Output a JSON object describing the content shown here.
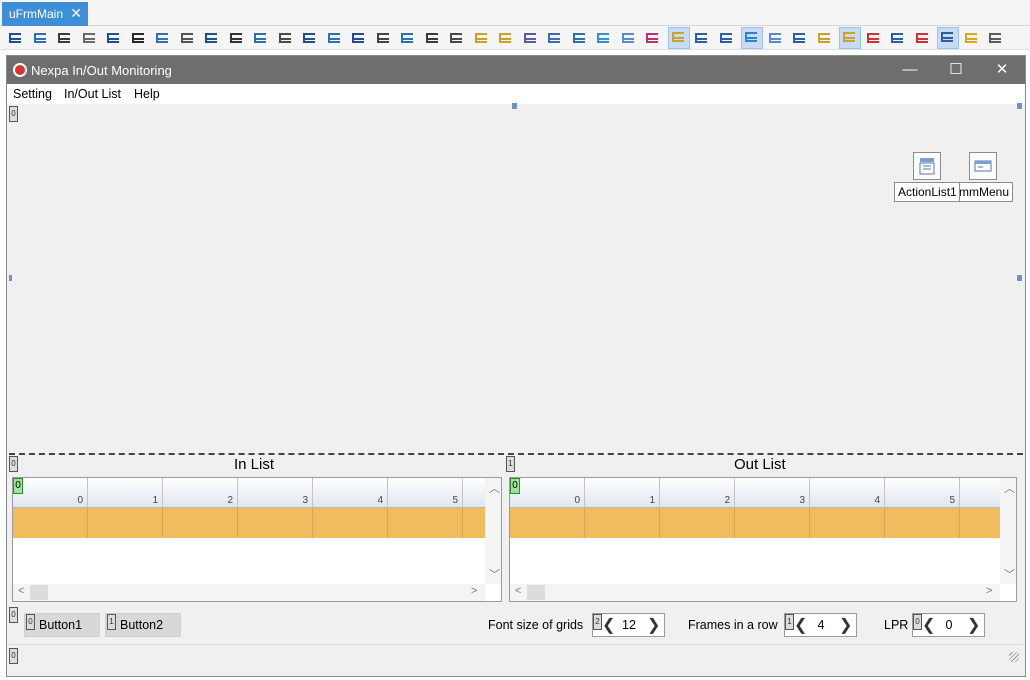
{
  "ide": {
    "tab_label": "uFrmMain",
    "tab_close": "✕",
    "toolbar_icons": [
      "align-left-icon",
      "align-right-icon",
      "align-center-icon",
      "align-top-icon",
      "align-bottom-icon",
      "align-middle-icon",
      "space-equal-h-icon",
      "space-inc-h-icon",
      "space-dec-h-icon",
      "center-h-icon",
      "center-v-icon",
      "size-width-icon",
      "size-height-icon",
      "size-both-icon",
      "size-grow-icon",
      "size-shrink-icon",
      "bring-front-icon",
      "send-back-icon",
      "group-icon",
      "component-icon",
      "component2-icon",
      "arrange-icon",
      "arrange2-icon",
      "tab-order-icon",
      "align-grid-icon",
      "snap-icon",
      "grid-icon",
      "form-icon",
      "table-icon",
      "copy-icon",
      "refresh-icon",
      "select-all-icon",
      "lines-icon",
      "dots-icon",
      "wrench-icon",
      "delete-icon",
      "debug-icon",
      "breakpoint-icon",
      "export-icon",
      "anchor-icon",
      "window-icon"
    ]
  },
  "form": {
    "title": "Nexpa In/Out Monitoring",
    "window_buttons": {
      "minimize": "—",
      "maximize": "☐",
      "close": "✕"
    },
    "menu": [
      "Setting",
      "In/Out List",
      "Help"
    ],
    "components": [
      {
        "label": "ActionList1",
        "icon": "action-list-icon"
      },
      {
        "label": "mmMenu",
        "icon": "main-menu-icon"
      }
    ],
    "tags": {
      "top": "0",
      "left_panel": "0",
      "right_panel": "1",
      "bottom": "0",
      "status": "0",
      "btn1": "0",
      "btn2": "1",
      "font": "2",
      "frames": "1",
      "lpr": "0"
    }
  },
  "in_list": {
    "title": "In List",
    "fixed": "0",
    "columns": [
      "0",
      "1",
      "2",
      "3",
      "4",
      "5"
    ]
  },
  "out_list": {
    "title": "Out List",
    "fixed": "0",
    "columns": [
      "0",
      "1",
      "2",
      "3",
      "4",
      "5"
    ]
  },
  "bottom": {
    "button1": "Button1",
    "button2": "Button2",
    "font_label": "Font size of grids",
    "font_value": "12",
    "frames_label": "Frames in a row",
    "frames_value": "4",
    "lpr_label": "LPR",
    "lpr_value": "0",
    "prev": "❮",
    "next": "❯"
  },
  "colors": {
    "row_highlight": "#f0bd5e",
    "titlebar": "#6e6e6e",
    "ide_tab": "#3f8fd8"
  }
}
